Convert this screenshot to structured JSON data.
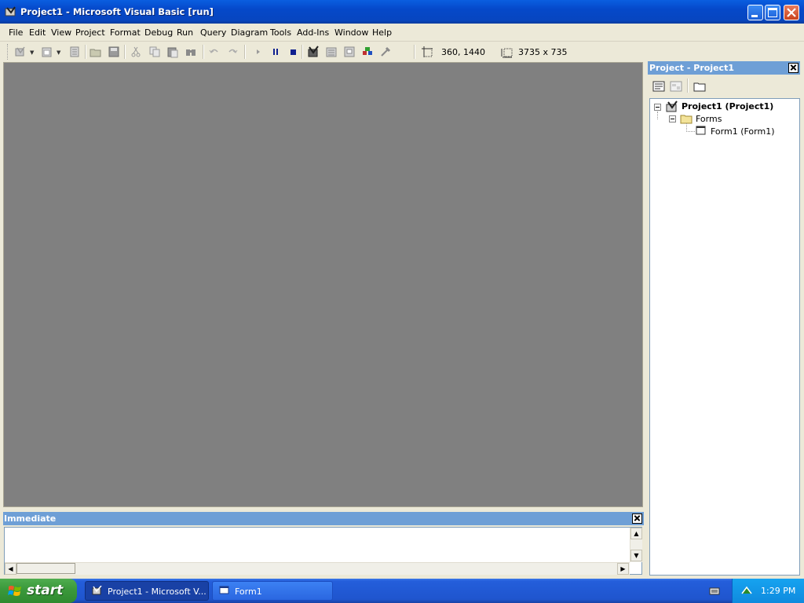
{
  "window": {
    "title": "Project1 - Microsoft Visual Basic [run]"
  },
  "menu": {
    "items": [
      "File",
      "Edit",
      "View",
      "Project",
      "Format",
      "Debug",
      "Run",
      "Query",
      "Diagram",
      "Tools",
      "Add-Ins",
      "Window",
      "Help"
    ]
  },
  "toolbar": {
    "position": "360, 1440",
    "size": "3735 x 735"
  },
  "immediate": {
    "title": "Immediate",
    "content": ""
  },
  "project_explorer": {
    "title": "Project - Project1",
    "tree": {
      "project": "Project1 (Project1)",
      "folder": "Forms",
      "form": "Form1 (Form1)"
    }
  },
  "taskbar": {
    "start_label": "start",
    "tasks": [
      {
        "label": "Project1 - Microsoft V..."
      },
      {
        "label": "Form1"
      }
    ],
    "clock": "1:29 PM"
  },
  "colors": {
    "titlebar": "#0548c9",
    "panel_title": "#6e9fd6",
    "mdi_background": "#808080",
    "taskbar": "#245edb",
    "start_green": "#3c9a3c"
  }
}
